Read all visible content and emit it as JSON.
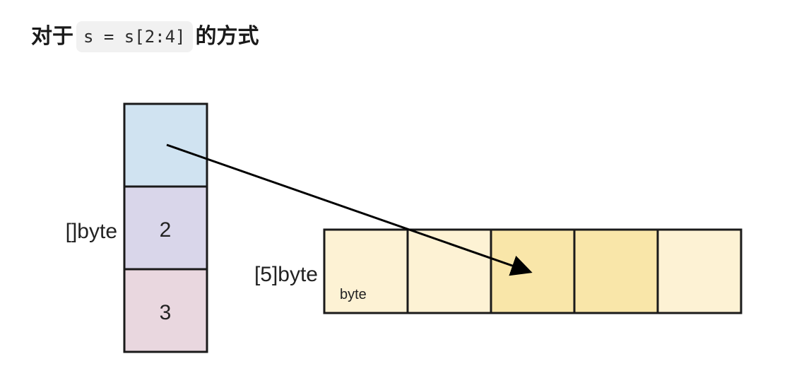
{
  "heading": {
    "prefix": "对于",
    "code": "s = s[2:4]",
    "suffix": "的方式"
  },
  "slice": {
    "label": "[]byte",
    "cells": [
      {
        "text": "",
        "color": "#d0e3f1"
      },
      {
        "text": "2",
        "color": "#d9d6ea"
      },
      {
        "text": "3",
        "color": "#e9d7df"
      }
    ]
  },
  "array": {
    "label": "[5]byte",
    "element_label": "byte",
    "cells": [
      {
        "color": "#fdf2d4"
      },
      {
        "color": "#fdf2d4"
      },
      {
        "color": "#f9e6a9"
      },
      {
        "color": "#f9e6a9"
      },
      {
        "color": "#fdf2d4"
      }
    ]
  },
  "colors": {
    "border": "#1a1a1a",
    "arrow": "#000000"
  }
}
